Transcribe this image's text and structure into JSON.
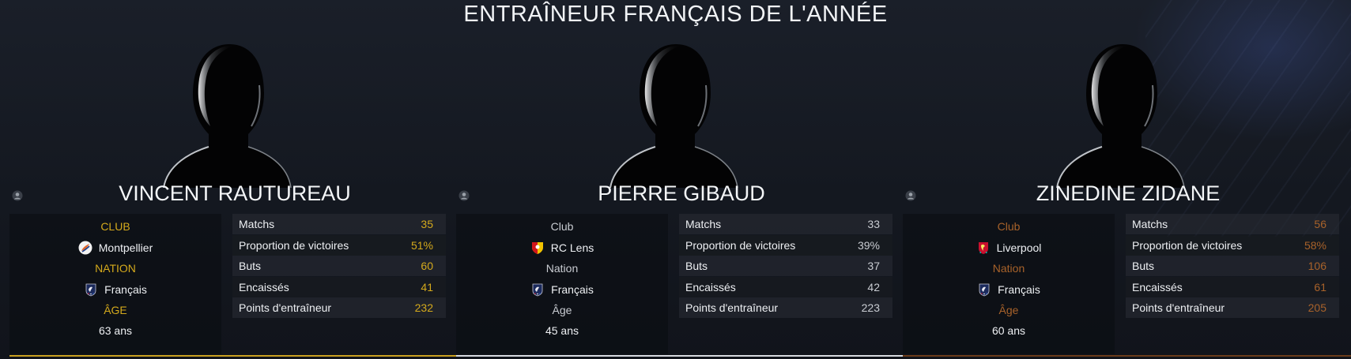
{
  "page_title": "ENTRAÎNEUR FRANÇAIS DE L'ANNÉE",
  "coaches": [
    {
      "name": "VINCENT RAUTUREAU",
      "accent_color": "#d4a91c",
      "line_color": "#c9a020",
      "info": {
        "club_label": "CLUB",
        "club_value": "Montpellier",
        "club_badge_icon": "montpellier-badge-icon",
        "nation_label": "NATION",
        "nation_value": "Français",
        "nation_badge_icon": "france-federation-icon",
        "age_label": "ÂGE",
        "age_value": "63 ans"
      },
      "stats": [
        {
          "label": "Matchs",
          "value": "35"
        },
        {
          "label": "Proportion de victoires",
          "value": "51%"
        },
        {
          "label": "Buts",
          "value": "60"
        },
        {
          "label": "Encaissés",
          "value": "41"
        },
        {
          "label": "Points d'entraîneur",
          "value": "232"
        }
      ]
    },
    {
      "name": "PIERRE GIBAUD",
      "accent_color": "#c9ccd2",
      "line_color": "#d6d9de",
      "info": {
        "club_label": "Club",
        "club_value": "RC Lens",
        "club_badge_icon": "rc-lens-badge-icon",
        "nation_label": "Nation",
        "nation_value": "Français",
        "nation_badge_icon": "france-federation-icon",
        "age_label": "Âge",
        "age_value": "45 ans"
      },
      "stats": [
        {
          "label": "Matchs",
          "value": "33"
        },
        {
          "label": "Proportion de victoires",
          "value": "39%"
        },
        {
          "label": "Buts",
          "value": "37"
        },
        {
          "label": "Encaissés",
          "value": "42"
        },
        {
          "label": "Points d'entraîneur",
          "value": "223"
        }
      ]
    },
    {
      "name": "ZINEDINE ZIDANE",
      "accent_color": "#a8622a",
      "line_color": "#6b3c1a",
      "info": {
        "club_label": "Club",
        "club_value": "Liverpool",
        "club_badge_icon": "liverpool-badge-icon",
        "nation_label": "Nation",
        "nation_value": "Français",
        "nation_badge_icon": "france-federation-icon",
        "age_label": "Âge",
        "age_value": "60 ans"
      },
      "stats": [
        {
          "label": "Matchs",
          "value": "56"
        },
        {
          "label": "Proportion de victoires",
          "value": "58%"
        },
        {
          "label": "Buts",
          "value": "106"
        },
        {
          "label": "Encaissés",
          "value": "61"
        },
        {
          "label": "Points d'entraîneur",
          "value": "205"
        }
      ]
    }
  ]
}
